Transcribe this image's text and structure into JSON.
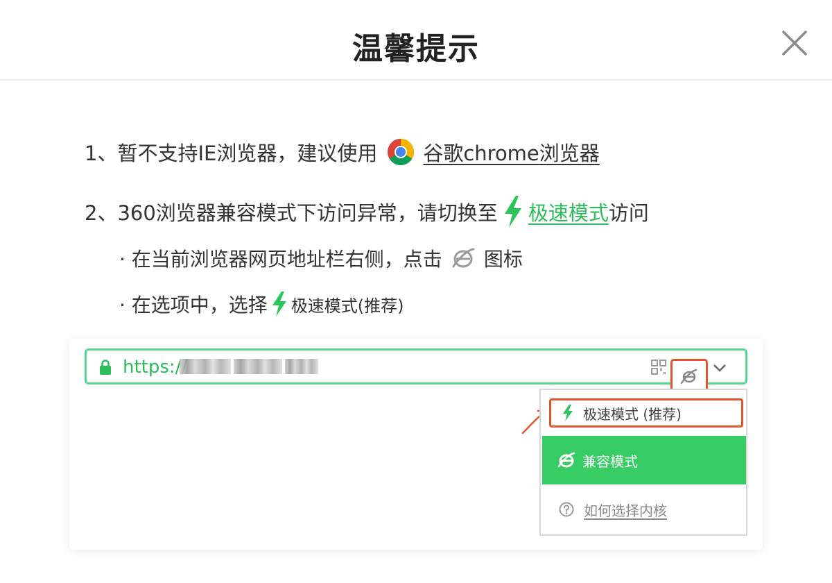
{
  "dialog": {
    "title": "温馨提示",
    "close_icon": "close-icon"
  },
  "tips": {
    "line1_prefix": "1、暂不支持IE浏览器，建议使用",
    "line1_link": "谷歌chrome浏览器",
    "line2_prefix": "2、360浏览器兼容模式下访问异常，请切换至",
    "line2_link": "极速模式",
    "line2_suffix": "访问",
    "sub1_prefix": "· 在当前浏览器网页地址栏右侧，点击",
    "sub1_suffix": "图标",
    "sub2_prefix": "· 在选项中，选择",
    "sub2_suffix": "极速模式(推荐)"
  },
  "demo": {
    "url_prefix": "https://",
    "menu_item_fast": "极速模式 (推荐)",
    "menu_item_compat": "兼容模式",
    "menu_item_help": "如何选择内核"
  },
  "colors": {
    "accent_green": "#37cc64",
    "link_green": "#2bbd5a",
    "highlight_red": "#e0542d"
  }
}
